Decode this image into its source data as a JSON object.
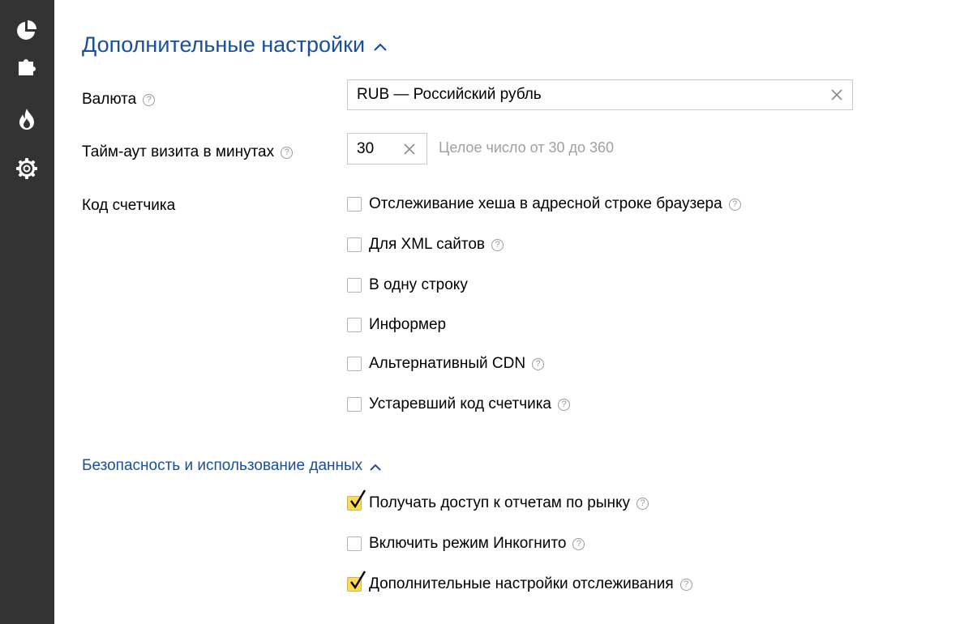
{
  "sidebar": {
    "items": [
      {
        "icon": "pie-chart-icon"
      },
      {
        "icon": "puzzle-icon"
      },
      {
        "icon": "flame-icon"
      },
      {
        "icon": "gear-icon"
      }
    ]
  },
  "section": {
    "title": "Дополнительные настройки"
  },
  "currency": {
    "label": "Валюта",
    "value": "RUB — Российский рубль"
  },
  "timeout": {
    "label": "Тайм-аут визита в минутах",
    "value": "30",
    "hint": "Целое число от 30 до 360"
  },
  "counter_code": {
    "label": "Код счетчика",
    "options": [
      {
        "label": "Отслеживание хеша в адресной строке браузера",
        "checked": false
      },
      {
        "label": "Для XML сайтов",
        "checked": false
      },
      {
        "label": "В одну строку",
        "checked": false
      },
      {
        "label": "Информер",
        "checked": false
      },
      {
        "label": "Альтернативный CDN",
        "checked": false
      },
      {
        "label": "Устаревший код счетчика",
        "checked": false
      }
    ]
  },
  "security": {
    "title": "Безопасность и использование данных",
    "options": [
      {
        "label": "Получать доступ к отчетам по рынку",
        "checked": true
      },
      {
        "label": "Включить режим Инкогнито",
        "checked": false
      },
      {
        "label": "Дополнительные настройки отслеживания",
        "checked": true
      }
    ]
  },
  "colors": {
    "sidebar_bg": "#333333",
    "link_blue": "#1a4fa0",
    "checkbox_checked": "#ffdb4d"
  }
}
